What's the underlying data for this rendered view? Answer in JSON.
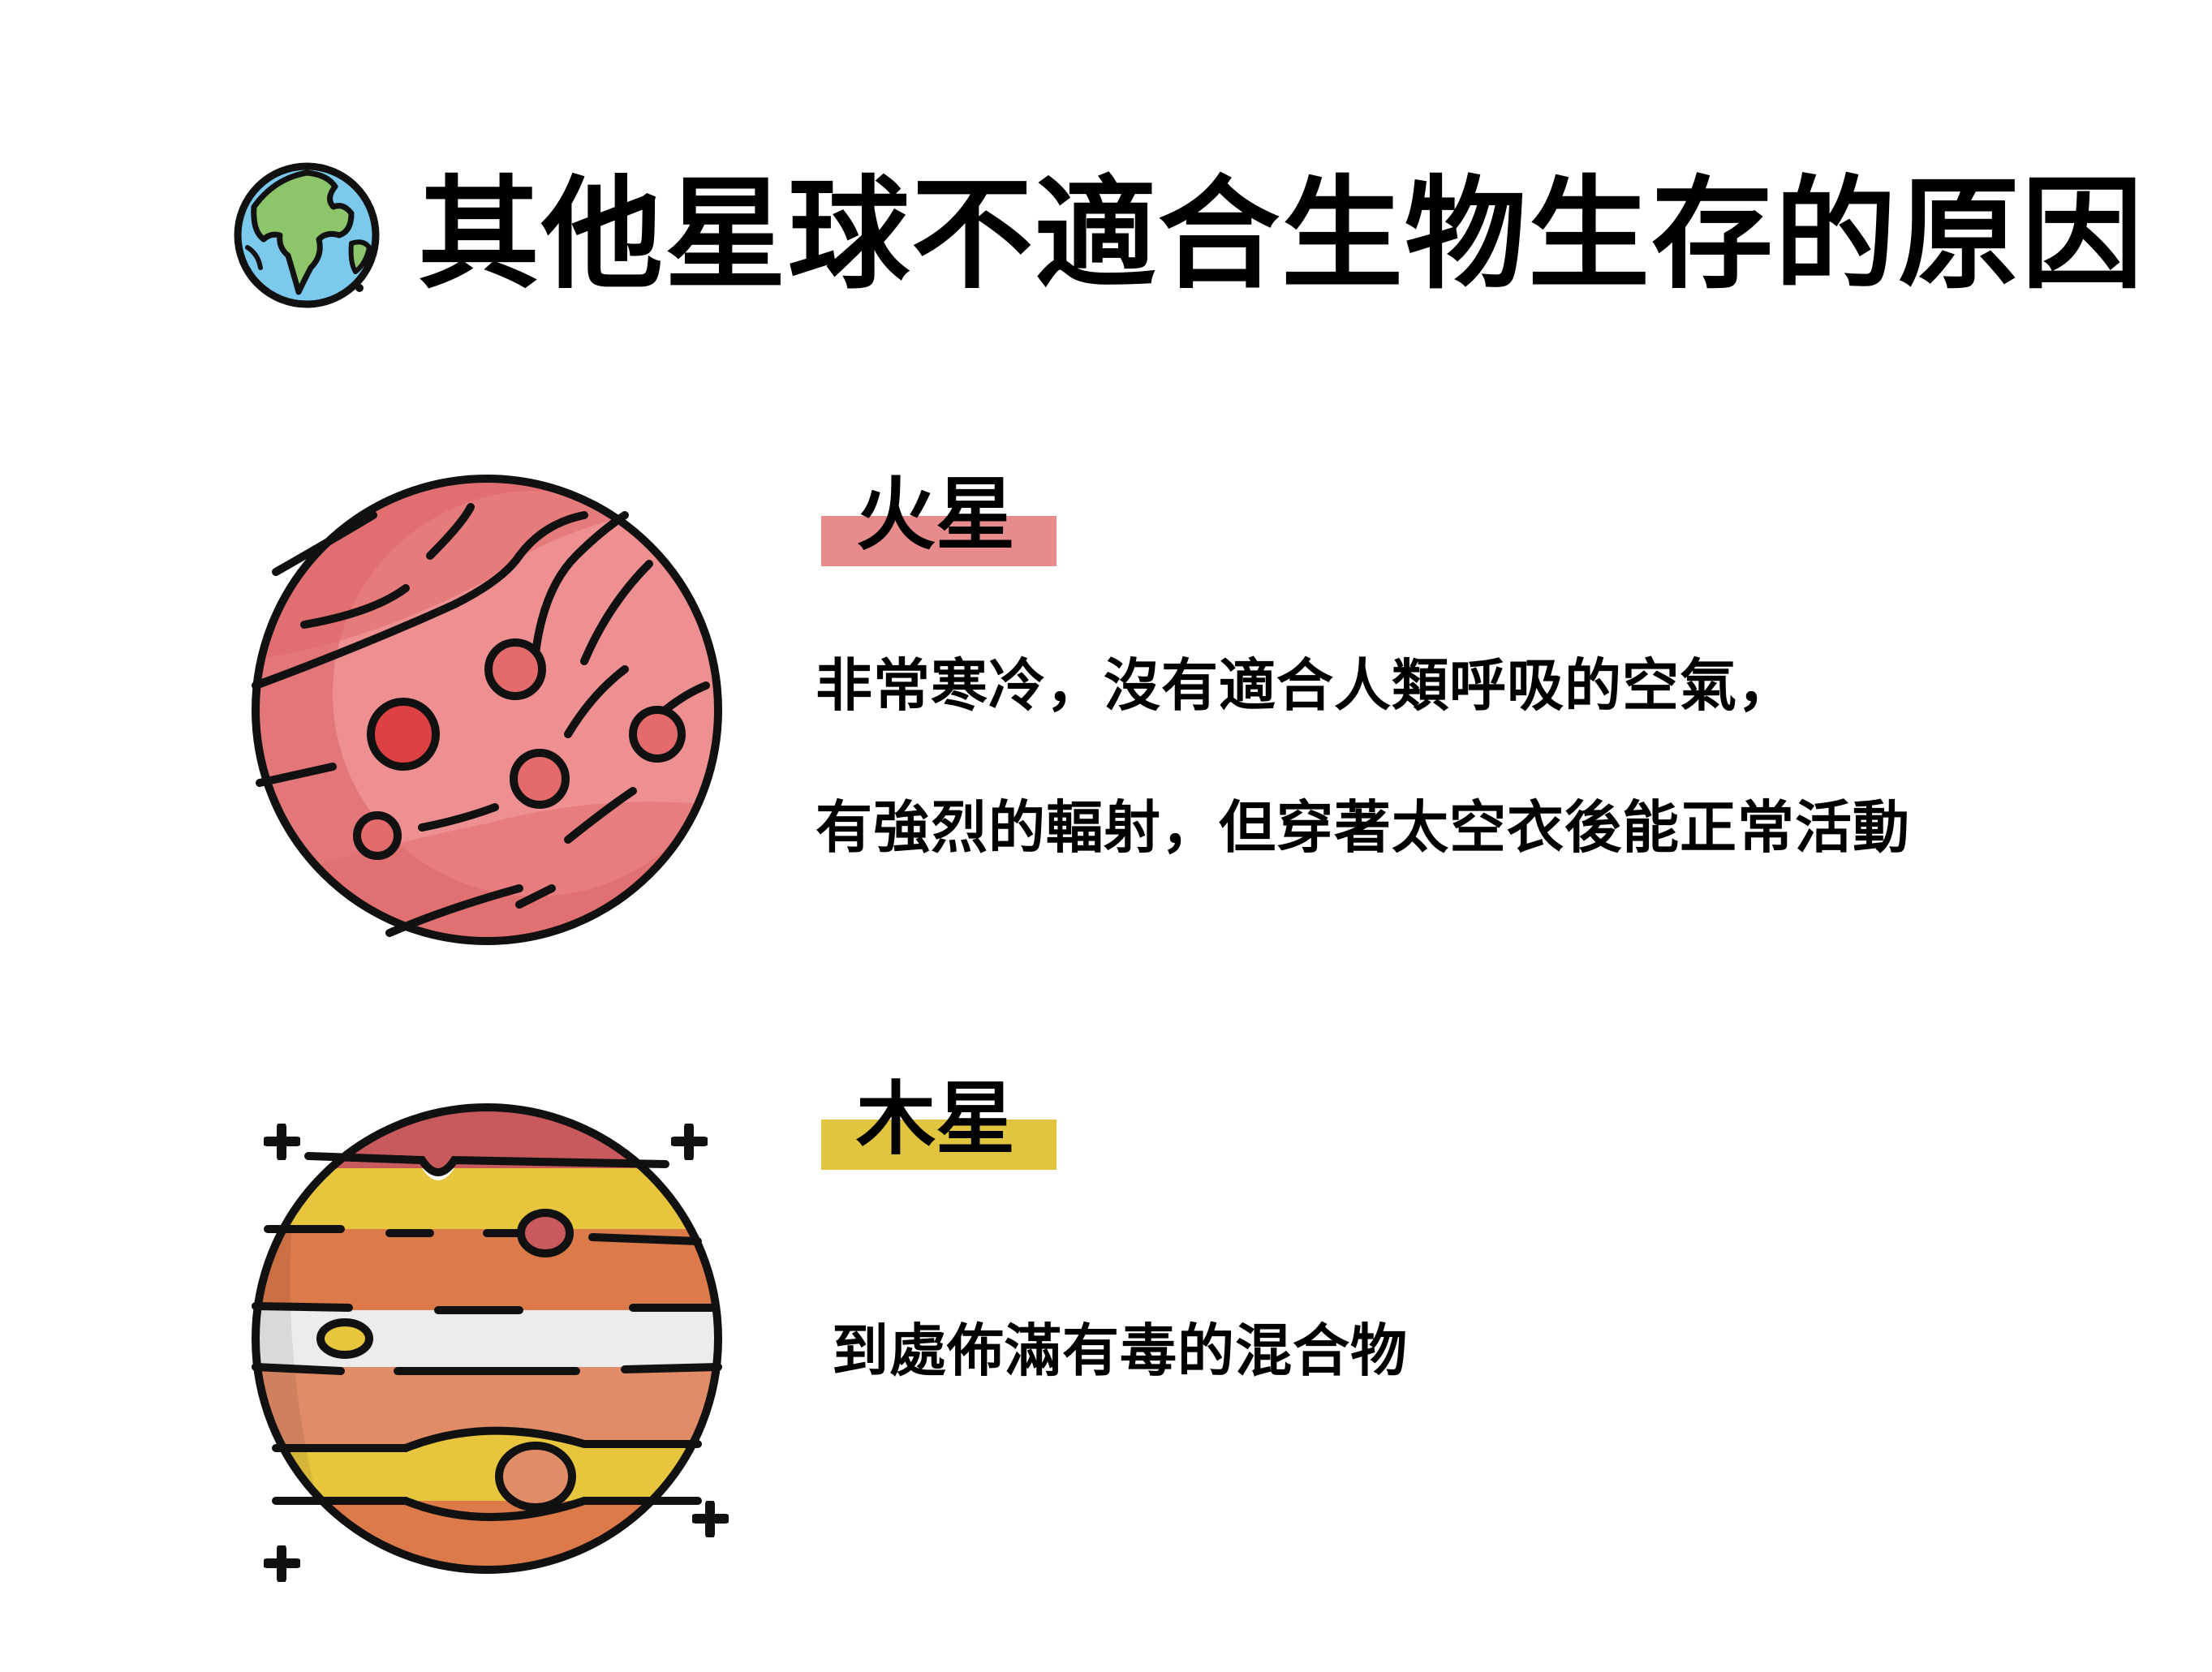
{
  "title": "其他星球不適合生物生存的原因",
  "title_icon": "earth-globe-icon",
  "sections": [
    {
      "name": "火星",
      "label_color": "#e88b8c",
      "planet_icon": "mars-icon",
      "lines": [
        "非常寒冷，沒有適合人類呼吸的空氣，",
        "有強烈的輻射，但穿著太空衣後能正常活動"
      ]
    },
    {
      "name": "木星",
      "label_color": "#e2c53f",
      "planet_icon": "jupiter-icon",
      "lines": [
        "到處佈滿有毒的混合物"
      ]
    }
  ]
}
